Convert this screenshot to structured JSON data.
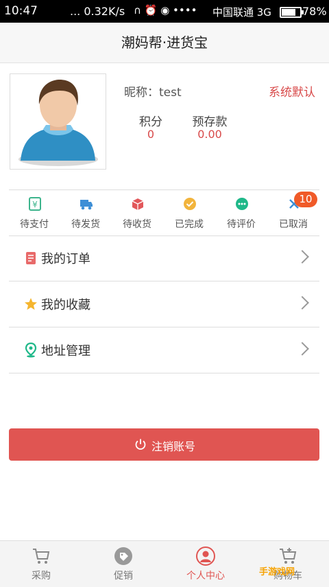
{
  "status_bar": {
    "time": "10:47",
    "network_speed": "... 0.32K/s",
    "icons_text": "∩ ⏰ ◉ ••••",
    "carrier": "中国联通 3G",
    "battery": "78%"
  },
  "header": {
    "title": "潮妈帮·进货宝"
  },
  "profile": {
    "nickname_label": "昵称：test",
    "default_label": "系统默认",
    "points_label": "积分",
    "points_value": "0",
    "deposit_label": "预存款",
    "deposit_value": "0.00"
  },
  "orders": {
    "items": [
      {
        "label": "待支付",
        "icon": "yen-payment-icon",
        "color": "#3cb48c"
      },
      {
        "label": "待发货",
        "icon": "delivery-truck-icon",
        "color": "#3e8fd6"
      },
      {
        "label": "待收货",
        "icon": "package-icon",
        "color": "#e2575a"
      },
      {
        "label": "已完成",
        "icon": "check-circle-icon",
        "color": "#f2b43c"
      },
      {
        "label": "待评价",
        "icon": "chat-bubble-icon",
        "color": "#1fb889"
      },
      {
        "label": "已取消",
        "icon": "cancel-x-icon",
        "color": "#3e8fd6"
      }
    ],
    "badge_count": "10"
  },
  "menu": {
    "items": [
      {
        "label": "我的订单",
        "icon": "order-list-icon"
      },
      {
        "label": "我的收藏",
        "icon": "star-icon"
      },
      {
        "label": "地址管理",
        "icon": "location-pin-icon"
      }
    ]
  },
  "logout": {
    "label": "注销账号"
  },
  "tabs": {
    "items": [
      {
        "label": "采购",
        "icon": "cart-icon"
      },
      {
        "label": "促销",
        "icon": "tag-icon"
      },
      {
        "label": "个人中心",
        "icon": "user-icon"
      },
      {
        "label": "购物车",
        "icon": "shopping-cart-icon"
      }
    ],
    "active_color": "#e05552"
  },
  "watermark": "手游戏网"
}
